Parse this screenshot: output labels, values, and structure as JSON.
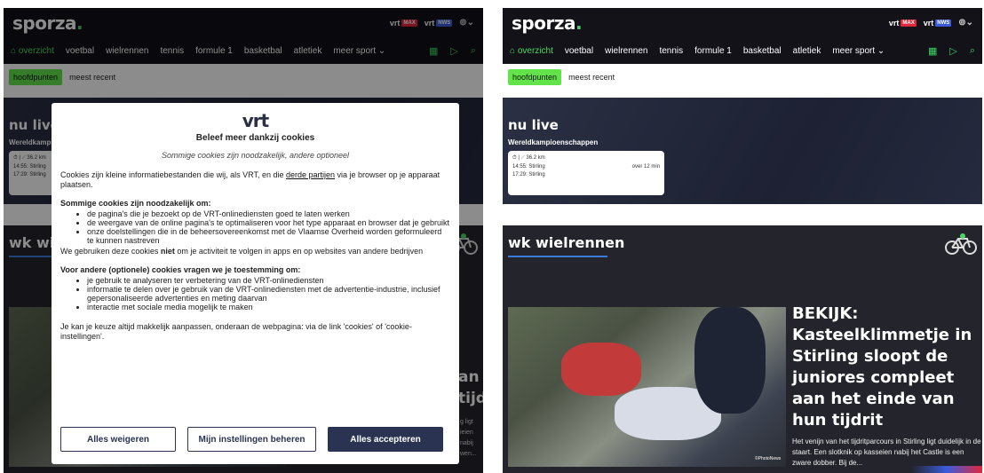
{
  "brand": {
    "logo": "sporza",
    "logo_dot": "."
  },
  "header": {
    "vrt_max": "vrt",
    "max_tag": "MAX",
    "vrt_nws": "vrt",
    "nws_tag": "NWS",
    "user_icon": "⊚⌄"
  },
  "nav": {
    "items": [
      "overzicht",
      "voetbal",
      "wielrennen",
      "tennis",
      "formule 1",
      "basketbal",
      "atletiek",
      "meer sport ⌄"
    ],
    "active": "overzicht",
    "icons": [
      "calendar-icon",
      "play-icon",
      "search-icon"
    ]
  },
  "subnav": {
    "tabs": [
      "hoofdpunten",
      "meest recent"
    ]
  },
  "live": {
    "title": "nu live",
    "event": "Wereldkampioenschappen",
    "card_meta": "⏱ | ⟋ 36.2 km",
    "row1": "14:55: Stirling",
    "row1_time": "over 12 min",
    "row2": "17:29: Stirling"
  },
  "section": {
    "title": "wk wielrennen"
  },
  "story": {
    "headline": "BEKIJK: Kasteelklimmetje in Stirling sloopt de juniores compleet aan het einde van hun tijdrit",
    "summary": "Het venijn van het tijdritparcours in Stirling ligt duidelijk in de staart. Een slotknik op kasseien nabij het Castle is een zware dobber. Bij de...",
    "credit": "©PhotoNews",
    "left_partial_headline": "an tijdrit",
    "left_partial_summary": "g ligt ieien nabij wen..."
  },
  "cookie": {
    "logo": "vrt",
    "title": "Beleef meer dankzij cookies",
    "subtitle": "Sommige cookies zijn noodzakelijk, andere optioneel",
    "intro_before": "Cookies zijn kleine informatiebestanden die wij, als VRT, en die ",
    "intro_link": "derde partijen",
    "intro_after": " via je browser op je apparaat plaatsen.",
    "necessary_heading": "Sommige cookies zijn noodzakelijk om:",
    "necessary_items": [
      "de pagina's die je bezoekt op de VRT-onlinediensten goed te laten werken",
      "de weergave van de online pagina's te optimaliseren voor het type apparaat en browser dat je gebruikt",
      "onze doelstellingen die in de beheersovereenkomst met de Vlaamse Overheid worden geformuleerd te kunnen nastreven"
    ],
    "no_track_before": "We gebruiken deze cookies ",
    "no_track_bold": "niet",
    "no_track_after": " om je activiteit te volgen in apps en op websites van andere bedrijven",
    "optional_heading": "Voor andere (optionele) cookies vragen we je toestemming om:",
    "optional_items": [
      "je gebruik te analyseren ter verbetering van de VRT-onlinediensten",
      "informatie te delen over je gebruik van de VRT-onlinediensten met de advertentie-industrie, inclusief gepersonaliseerde advertenties en meting daarvan",
      "interactie met sociale media mogelijk te maken"
    ],
    "footer_text": "Je kan je keuze altijd makkelijk aanpassen, onderaan de webpagina: via de link 'cookies' of 'cookie-instellingen'.",
    "buttons": {
      "reject": "Alles weigeren",
      "manage": "Mijn instellingen beheren",
      "accept": "Alles accepteren"
    }
  },
  "colors": {
    "accent": "#4cd964",
    "pill": "#62e34a",
    "modal_button": "#2a3452",
    "underline": "#3b7bdc"
  }
}
